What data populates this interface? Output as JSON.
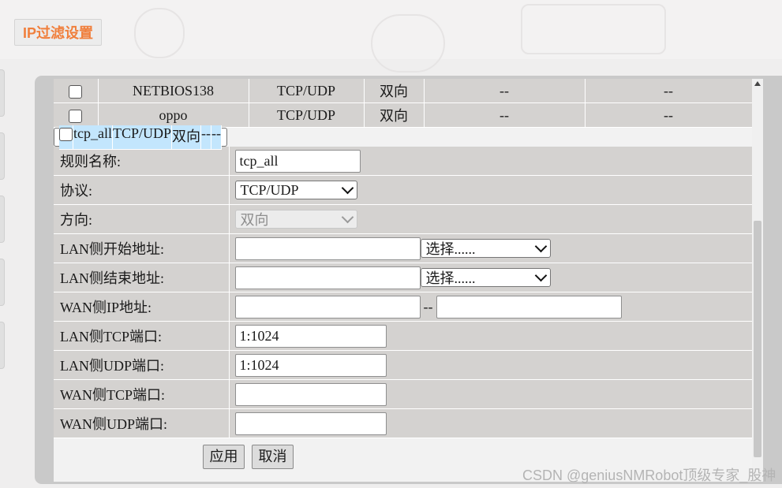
{
  "page": {
    "title_button": "IP过滤设置"
  },
  "rules_table": {
    "rows": [
      {
        "name": "NETBIOS138",
        "protocol": "TCP/UDP",
        "direction": "双向",
        "col5": "--",
        "col6": "--",
        "selected": false
      },
      {
        "name": "oppo",
        "protocol": "TCP/UDP",
        "direction": "双向",
        "col5": "--",
        "col6": "--",
        "selected": false
      },
      {
        "name": "tcp_all",
        "protocol": "TCP/UDP",
        "direction": "双向",
        "col5": "--",
        "col6": "--",
        "selected": true
      }
    ]
  },
  "form": {
    "rule_name": {
      "label": "规则名称:",
      "value": "tcp_all"
    },
    "protocol": {
      "label": "协议:",
      "value": "TCP/UDP"
    },
    "direction": {
      "label": "方向:",
      "value": "双向"
    },
    "lan_start": {
      "label": "LAN侧开始地址:",
      "value": "",
      "select": "选择......"
    },
    "lan_end": {
      "label": "LAN侧结束地址:",
      "value": "",
      "select": "选择......"
    },
    "wan_ip": {
      "label": "WAN侧IP地址:",
      "from": "",
      "sep": "--",
      "to": ""
    },
    "lan_tcp": {
      "label": "LAN侧TCP端口:",
      "value": "1:1024"
    },
    "lan_udp": {
      "label": "LAN侧UDP端口:",
      "value": "1:1024"
    },
    "wan_tcp": {
      "label": "WAN侧TCP端口:",
      "value": ""
    },
    "wan_udp": {
      "label": "WAN侧UDP端口:",
      "value": ""
    }
  },
  "actions": {
    "apply": "应用",
    "cancel": "取消"
  },
  "watermark": "CSDN @geniusNMRobot顶级专家_股神"
}
